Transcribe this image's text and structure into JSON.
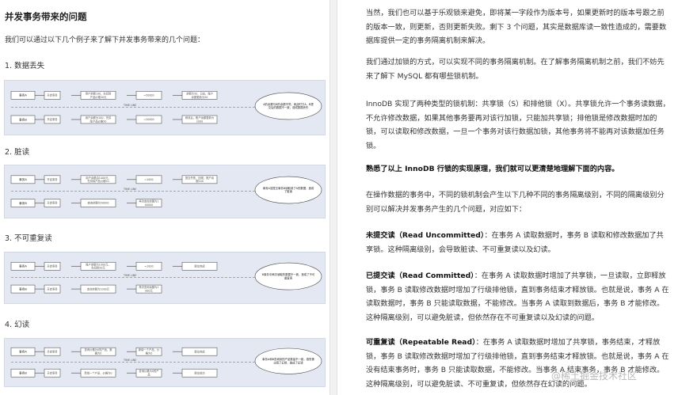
{
  "left": {
    "title": "并发事务带来的问题",
    "intro": "我们可以通过以下几个例子来了解下并发事务带来的几个问题：",
    "sections": [
      {
        "heading": "1. 数据丢失",
        "diagram": {
          "a_label": "事务A",
          "b_label": "事务B",
          "a_steps": [
            "开启事务",
            "用户余额100，先扣除产品价格50元",
            "=50000",
            "余额为50，日志，账户余额更新为50"
          ],
          "b_steps": [
            "开启事务",
            "用户余额为100，先扣除产品价格50",
            "=20000",
            "修改后，账户余额更新为2000"
          ],
          "timeline": "TIME LINE",
          "note": "A的余额与B的余额不同，而此时又A，B提交后的数据不一致，造成数据丢失"
        }
      },
      {
        "heading": "2. 脏读",
        "diagram": {
          "a_label": "事务A",
          "b_label": "事务B",
          "a_steps": [
            "开启事务",
            "用户余额由1000元，先扣除产品价格50",
            "=1000",
            "提交失败，回滚，账户余额100"
          ],
          "b_steps": [
            "开启事务",
            "查询余额为50000",
            "再次查询余额为100000"
          ],
          "timeline": "TIME LINE",
          "note": "事务A没提交事务B读取到了A的数据，造成了脏读"
        }
      },
      {
        "heading": "3. 不可重复读",
        "diagram": {
          "a_label": "事务A",
          "b_label": "事务B",
          "a_steps": [
            "开启事务",
            "账户余额为1000元，先扣除50元",
            "=1000",
            "提交完成"
          ],
          "b_steps": [
            "开启事务",
            "查询余额为1000元",
            "再次查询余额为1000元"
          ],
          "timeline": "TIME LINE",
          "note": "B事务中两次读取的数据不一致，造成了不可重复读"
        }
      },
      {
        "heading": "4. 幻读",
        "diagram": {
          "a_label": "事务A",
          "b_label": "事务B",
          "a_steps": [
            "开启事务",
            "查询价格为0的产品，数据为0",
            "新增一个产品，价格为0",
            "提交完成"
          ],
          "b_steps": [
            "开启事务",
            "新增一个产品，价格为0",
            "查询价格为0的产品",
            "提交成功"
          ],
          "timeline": "TIME LINE",
          "note": "事务A和B查询到的产品数量不一致，感觉像出现了幻觉，造成了幻读"
        }
      }
    ]
  },
  "right": {
    "paragraphs": [
      {
        "bold": "",
        "text": "当然，我们也可以基于乐观锁来避免，即将某一字段作为版本号，如果更新时的版本号跟之前的版本一致，则更新，否则更新失败。剩下 3 个问题，其实是数据库读一致性造成的，需要数据库提供一定的事务隔离机制来解决。"
      },
      {
        "bold": "",
        "text": "我们通过加锁的方式，可以实现不同的事务隔离机制。在了解事务隔离机制之前，我们不妨先来了解下 MySQL 都有哪些锁机制。"
      },
      {
        "bold": "",
        "text": "InnoDB 实现了两种类型的锁机制：共享锁（S）和排他锁（X）。共享锁允许一个事务读数据，不允许修改数据，如果其他事务要再对该行加锁，只能加共享锁；排他锁是修改数据时加的锁，可以读取和修改数据，一旦一个事务对该行数据加锁，其他事务将不能再对该数据加任务锁。"
      },
      {
        "bold": "熟悉了以上 InnoDB 行锁的实现原理，我们就可以更清楚地理解下面的内容。",
        "text": ""
      },
      {
        "bold": "",
        "text": "在操作数据的事务中，不同的锁机制会产生以下几种不同的事务隔离级别，不同的隔离级别分别可以解决并发事务产生的几个问题，对应如下："
      },
      {
        "bold": "未提交读（Read Uncommitted）",
        "text": "：在事务 A 读取数据时，事务 B 读取和修改数据加了共享锁。这种隔离级别，会导致脏读、不可重复读以及幻读。"
      },
      {
        "bold": "已提交读（Read Committed）",
        "text": "：在事务 A 读取数据时增加了共享锁，一旦读取，立即释放锁，事务 B 读取修改数据时增加了行级排他锁，直到事务结束才释放锁。也就是说，事务 A 在读取数据时，事务 B 只能读取数据，不能修改。当事务 A 读取到数据后，事务 B 才能修改。这种隔离级别，可以避免脏读，但依然存在不可重复读以及幻读的问题。"
      },
      {
        "bold": "可重复读（Repeatable Read）",
        "text": "：在事务 A 读取数据时增加了共享锁，事务结束，才释放锁，事务 B 读取修改数据时增加了行级排他锁，直到事务结束才释放锁。也就是说，事务 A 在没有结束事务时，事务 B 只能读取数据，不能修改。当事务 A 结束事务，事务 B 才能修改。这种隔离级别，可以避免脏读、不可重复读，但依然存在幻读的问题。"
      }
    ],
    "watermark": "@稀土掘金技术社区"
  }
}
